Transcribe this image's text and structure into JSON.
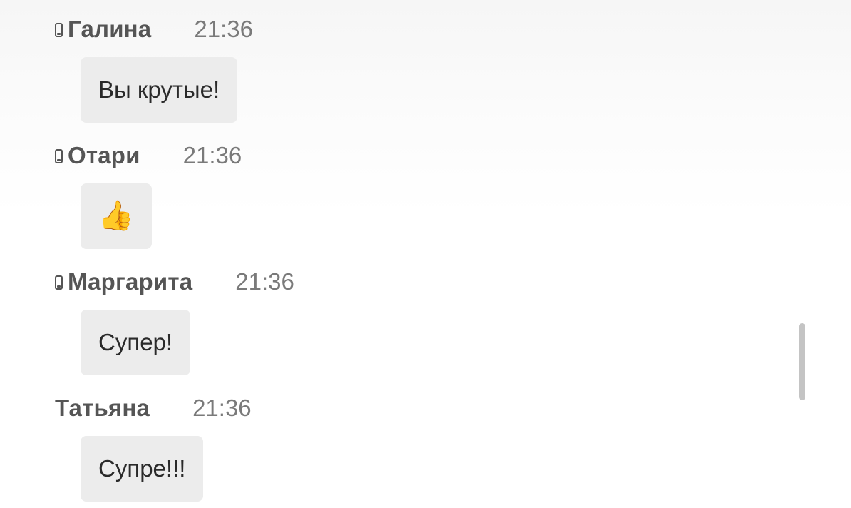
{
  "messages": [
    {
      "author": "Галина",
      "time": "21:36",
      "text": "Вы крутые!",
      "icon": "phone-icon"
    },
    {
      "author": "Отари",
      "time": "21:36",
      "text": "👍",
      "icon": "phone-icon"
    },
    {
      "author": "Маргарита",
      "time": "21:36",
      "text": "Супер!",
      "icon": "phone-icon"
    },
    {
      "author": "Татьяна",
      "time": "21:36",
      "text": "Супре!!!",
      "icon": ""
    }
  ],
  "colors": {
    "bubble": "#ececec",
    "author": "#555555",
    "time": "#7a7a7a",
    "scrollbar": "#c4c4c4"
  }
}
